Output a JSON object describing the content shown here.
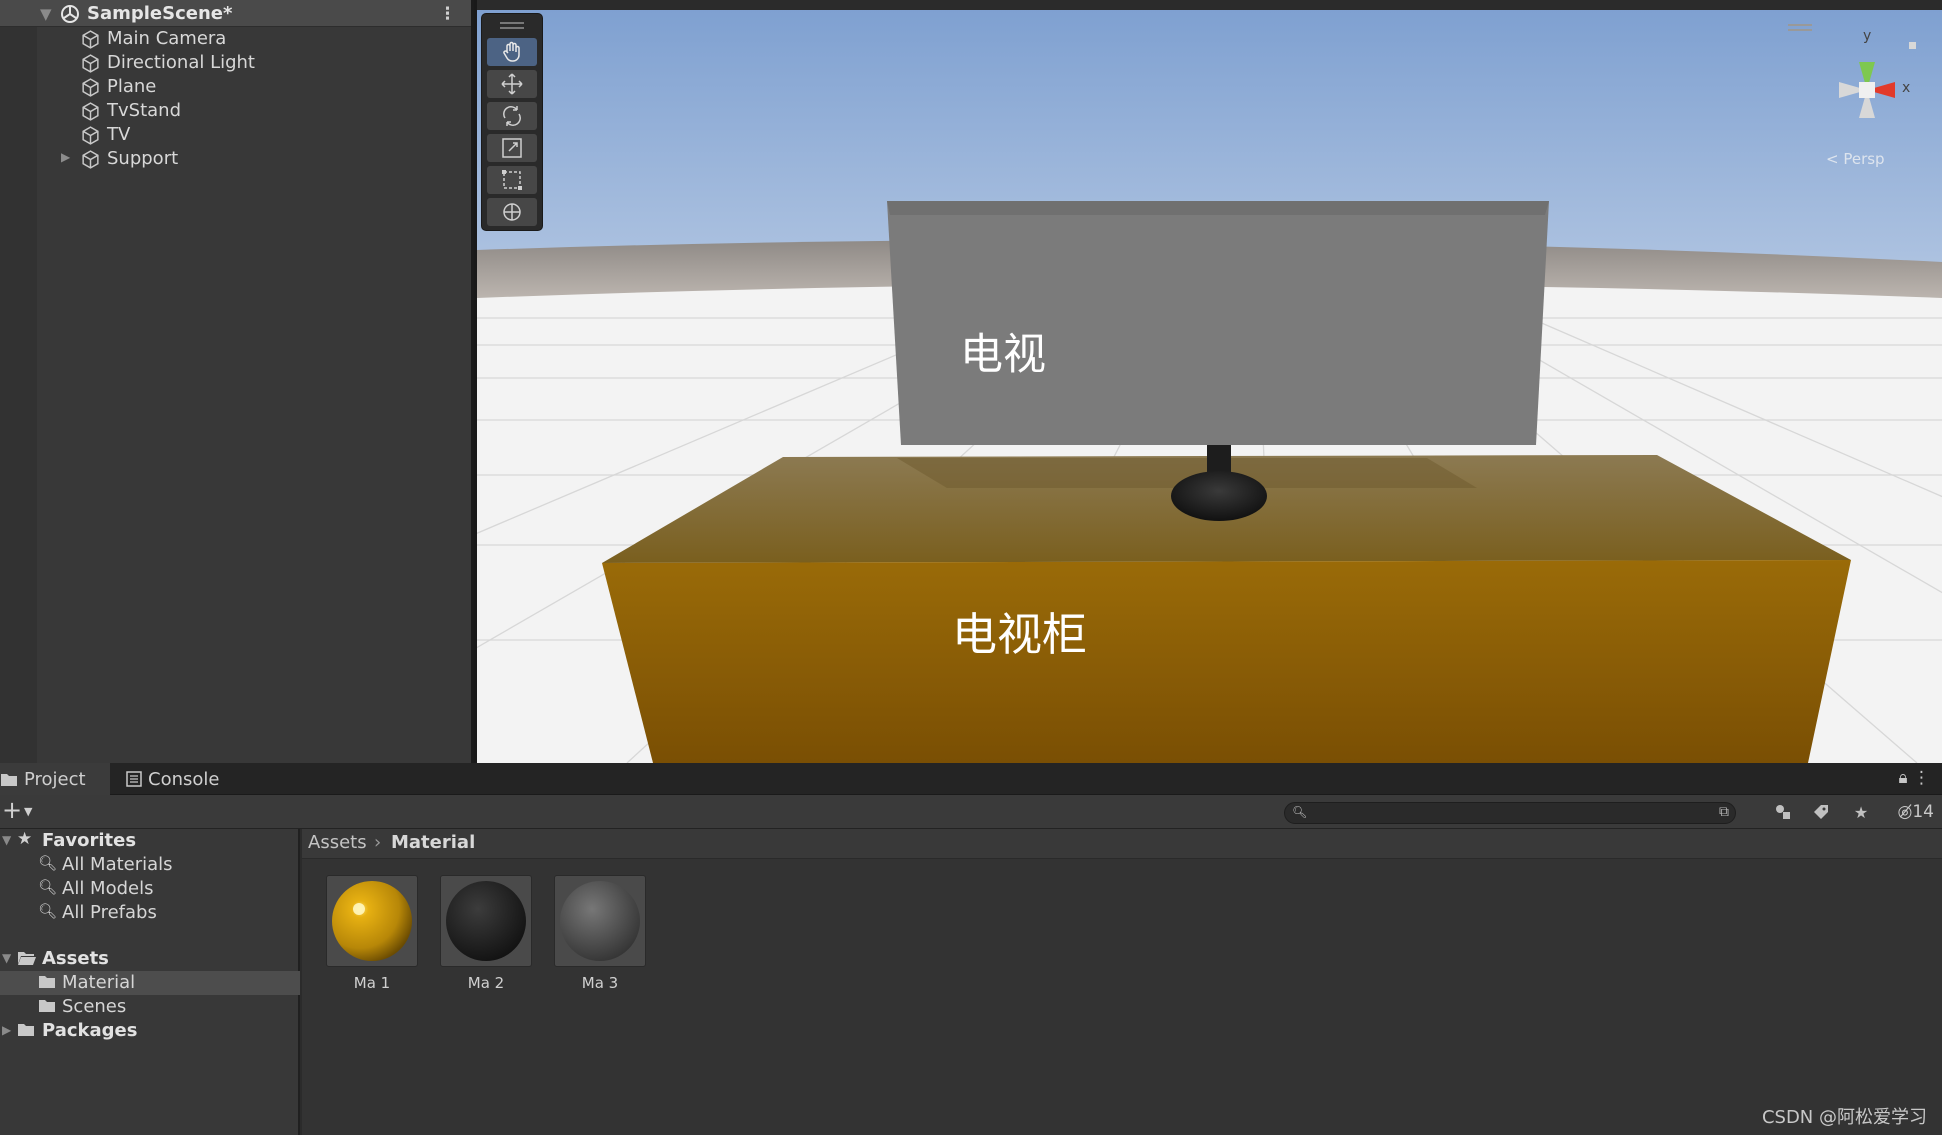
{
  "hierarchy": {
    "scene_title": "SampleScene*",
    "objects": [
      {
        "label": "Main Camera",
        "icon": "gameobject-cube-icon",
        "expandable": false
      },
      {
        "label": "Directional Light",
        "icon": "gameobject-cube-icon",
        "expandable": false
      },
      {
        "label": "Plane",
        "icon": "gameobject-cube-icon",
        "expandable": false
      },
      {
        "label": "TvStand",
        "icon": "gameobject-cube-icon",
        "expandable": false
      },
      {
        "label": "TV",
        "icon": "gameobject-cube-icon",
        "expandable": false
      },
      {
        "label": "Support",
        "icon": "gameobject-cube-icon",
        "expandable": true
      }
    ]
  },
  "scene_view": {
    "tools": [
      "hand-tool-icon",
      "move-tool-icon",
      "rotate-tool-icon",
      "scale-tool-icon",
      "rect-tool-icon",
      "transform-tool-icon"
    ],
    "active_tool": "hand-tool-icon",
    "gizmo": {
      "y_label": "y",
      "x_label": "x",
      "projection_label": "< Persp"
    },
    "tv_label": "电视",
    "stand_label": "电视柜",
    "colors": {
      "sky_top": "#8aa9d6",
      "floor": "#f2f2f2",
      "tv_screen": "#7e7e7e",
      "stand_top": "#8a6a2a",
      "stand_front": "#8f6308"
    }
  },
  "project": {
    "tabs": [
      {
        "label": "Project",
        "icon": "folder-icon",
        "active": true
      },
      {
        "label": "Console",
        "icon": "console-icon",
        "active": false
      }
    ],
    "hidden_count": "14",
    "tree": {
      "favorites_label": "Favorites",
      "favorites": [
        "All Materials",
        "All Models",
        "All Prefabs"
      ],
      "assets_label": "Assets",
      "assets_children": [
        "Material",
        "Scenes"
      ],
      "selected": "Material",
      "packages_label": "Packages"
    },
    "breadcrumb": {
      "root": "Assets",
      "current": "Material"
    },
    "assets": [
      {
        "name": "Ma 1",
        "color": "#c8960a"
      },
      {
        "name": "Ma 2",
        "color": "#222222"
      },
      {
        "name": "Ma 3",
        "color": "#555555"
      }
    ]
  },
  "watermark": "CSDN @阿松爱学习"
}
